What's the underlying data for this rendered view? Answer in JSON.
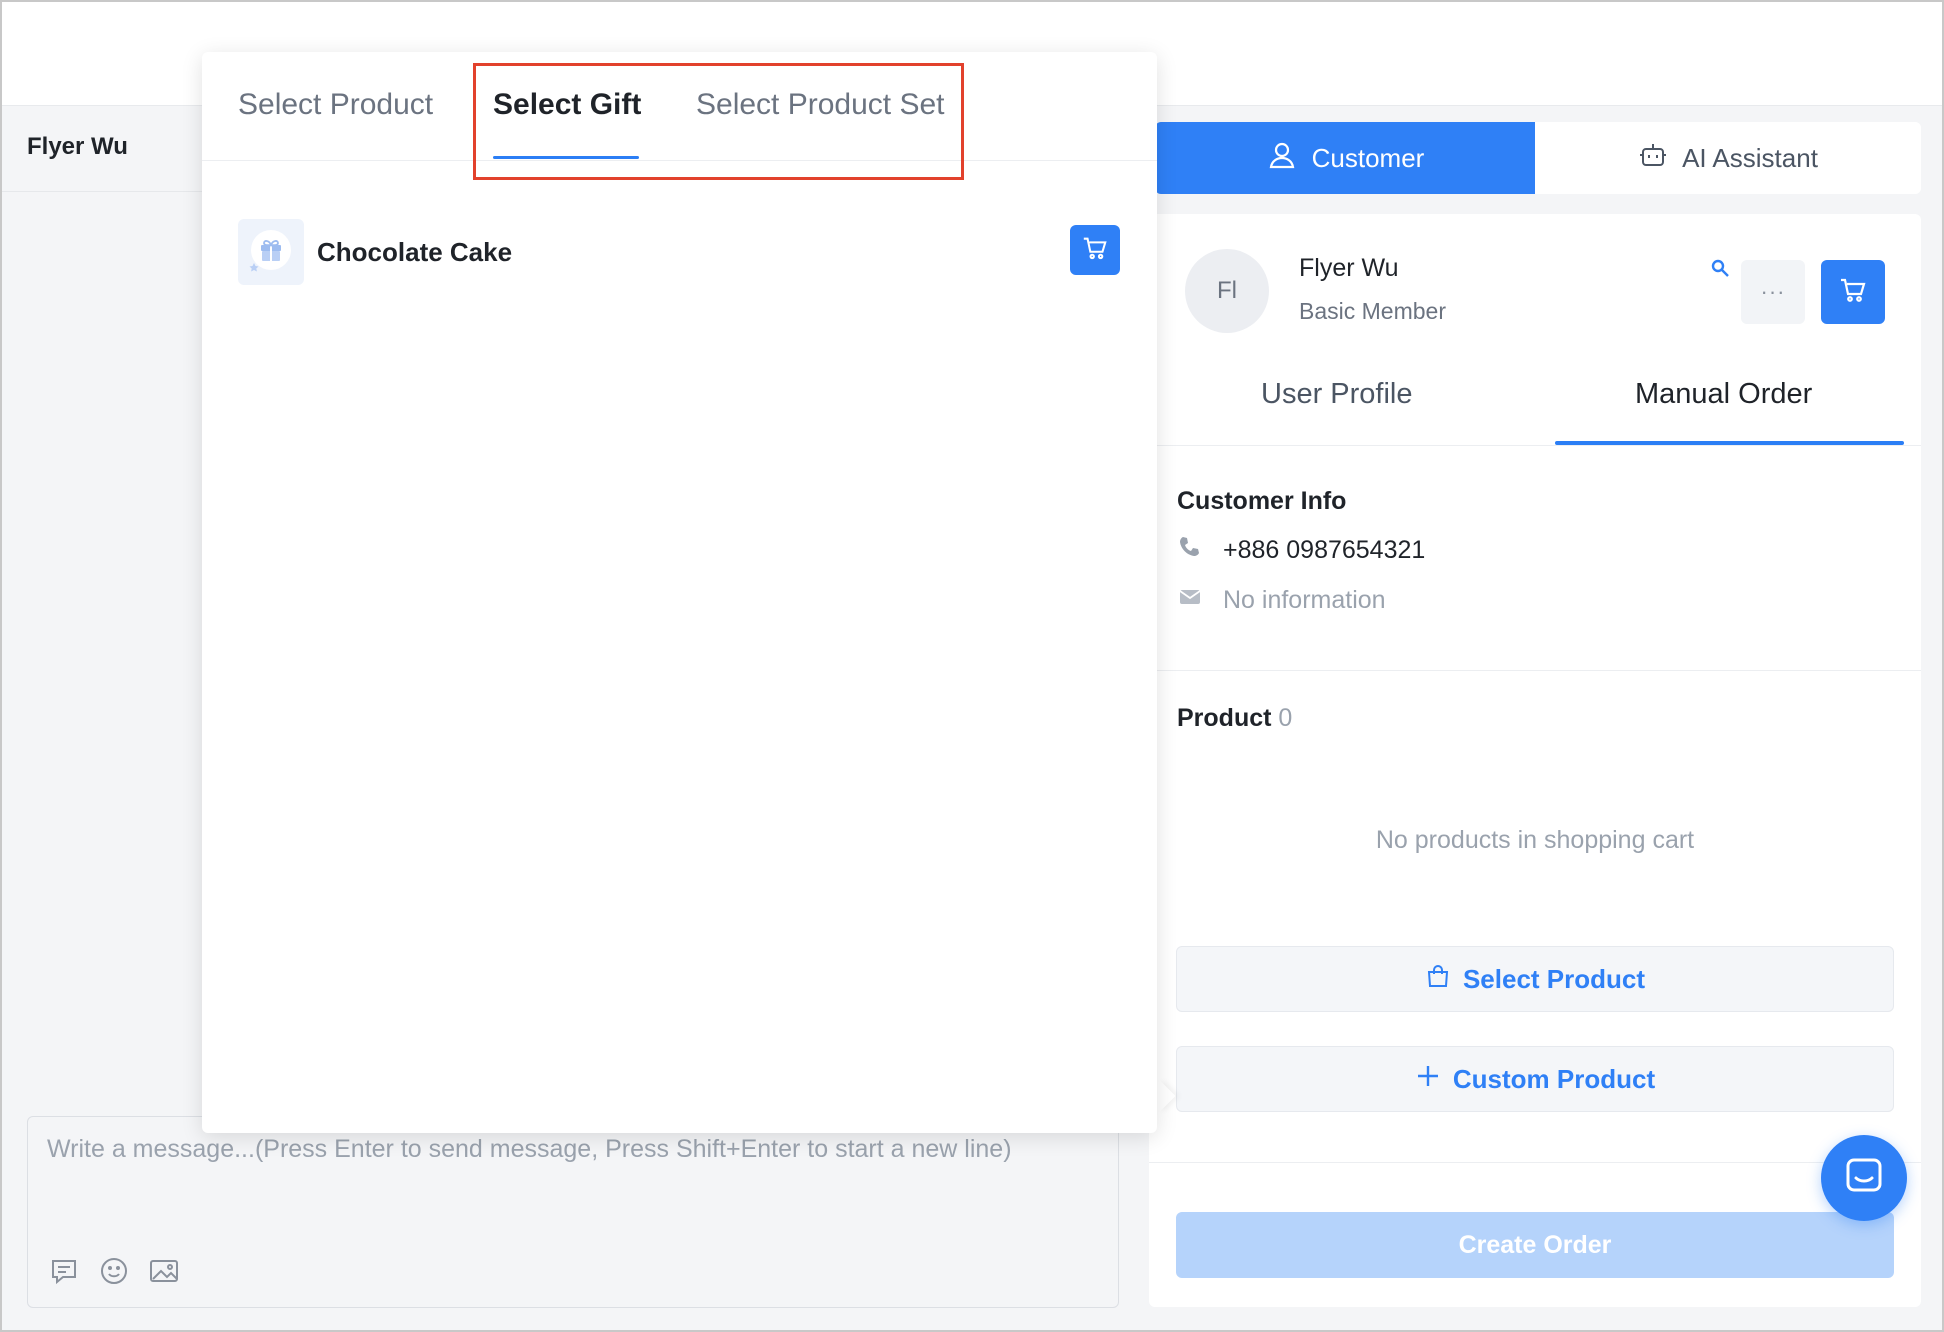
{
  "chat": {
    "contact_name": "Flyer Wu",
    "composer_placeholder": "Write a message...(Press Enter to send message, Press Shift+Enter to start a new line)",
    "tool_icons": [
      "quick-reply-icon",
      "emoji-icon",
      "image-icon"
    ]
  },
  "popover": {
    "tabs": [
      {
        "label": "Select Product",
        "active": false
      },
      {
        "label": "Select Gift",
        "active": true
      },
      {
        "label": "Select Product Set",
        "active": false
      }
    ],
    "items": [
      {
        "name": "Chocolate Cake",
        "icon": "gift-icon"
      }
    ]
  },
  "right_panel": {
    "segments": [
      {
        "label": "Customer",
        "icon": "user-icon",
        "active": true
      },
      {
        "label": "AI Assistant",
        "icon": "robot-icon",
        "active": false
      }
    ],
    "customer": {
      "initials": "Fl",
      "name": "Flyer Wu",
      "level": "Basic Member",
      "more_label": "···"
    },
    "tabs": [
      {
        "label": "User Profile",
        "active": false
      },
      {
        "label": "Manual Order",
        "active": true
      }
    ],
    "customer_info": {
      "title": "Customer Info",
      "phone": "+886 0987654321",
      "email": "No information"
    },
    "products": {
      "title": "Product",
      "count": "0",
      "empty_text": "No products in shopping cart",
      "select_product_label": "Select Product",
      "custom_product_label": "Custom Product"
    },
    "create_order_label": "Create Order"
  },
  "colors": {
    "accent": "#2f80f6",
    "highlight_box": "#e2412c",
    "disabled_button": "#b5d3fb"
  }
}
